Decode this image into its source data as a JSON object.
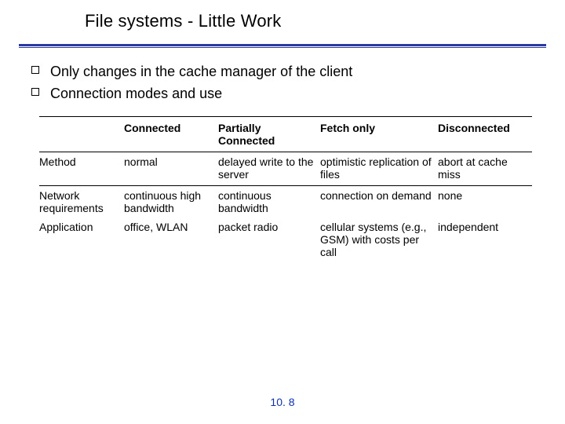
{
  "title": "File systems - Little Work",
  "bullets": [
    "Only changes in the cache manager of the client",
    "Connection modes and use"
  ],
  "table": {
    "headers": [
      "",
      "Connected",
      "Partially Connected",
      "Fetch only",
      "Disconnected"
    ],
    "rows": [
      {
        "label": "Method",
        "cells": [
          "normal",
          "delayed write to the server",
          "optimistic replication of files",
          "abort at cache miss"
        ]
      },
      {
        "label": "Network requirements",
        "cells": [
          "continuous high bandwidth",
          "continuous bandwidth",
          "connection on demand",
          "none"
        ]
      },
      {
        "label": "Application",
        "cells": [
          "office, WLAN",
          "packet radio",
          "cellular systems (e.g., GSM) with costs per call",
          "independent"
        ]
      }
    ]
  },
  "page_number": "10. 8"
}
